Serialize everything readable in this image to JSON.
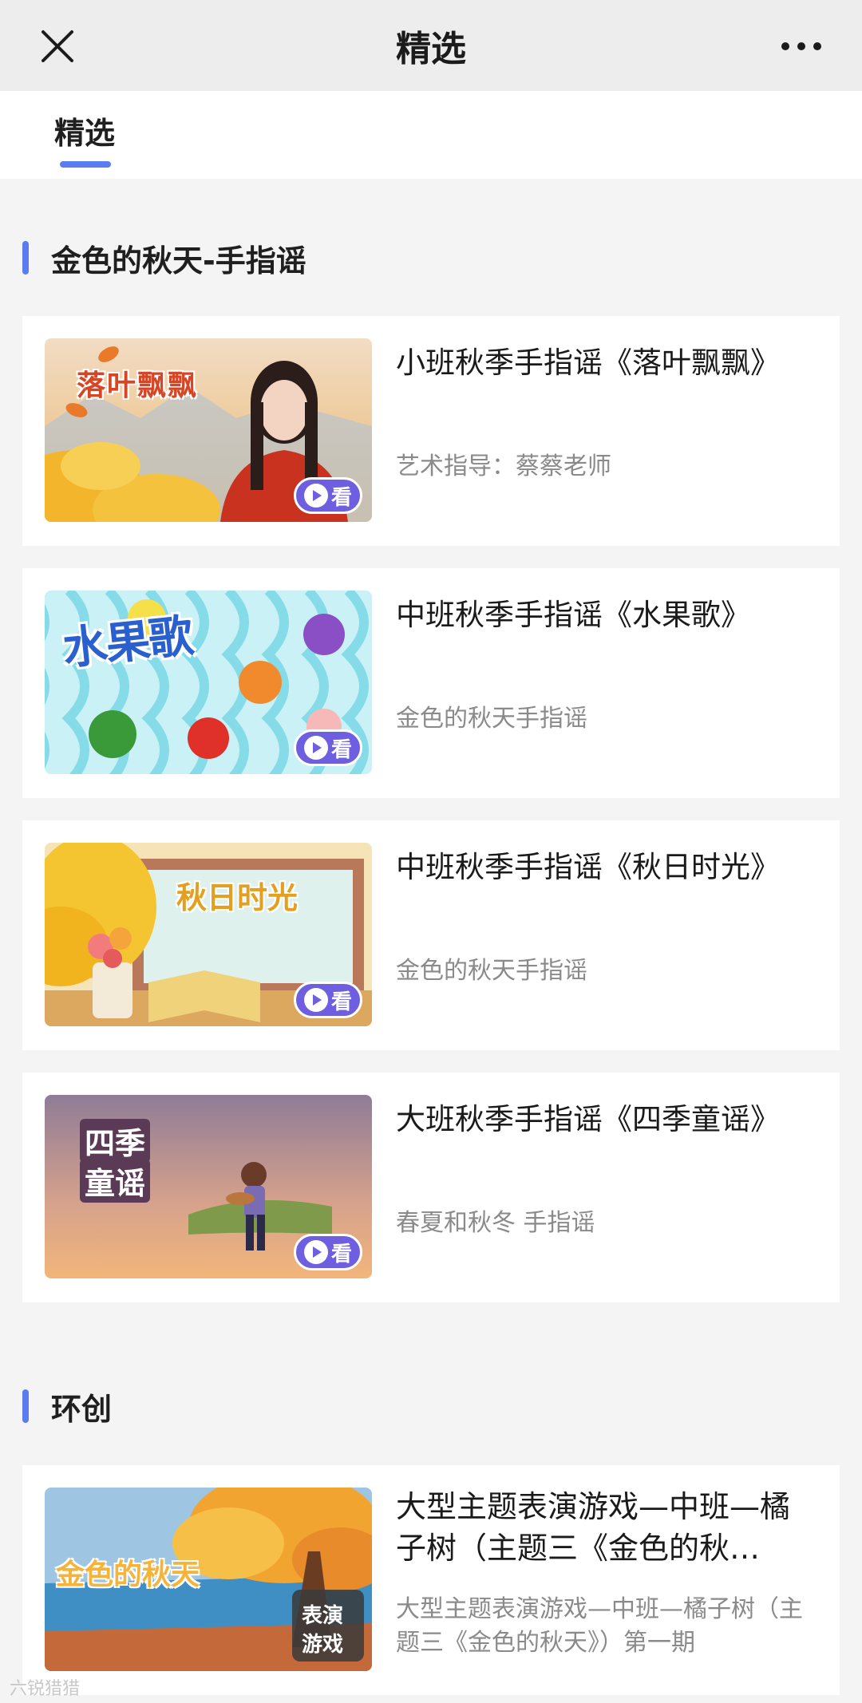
{
  "navbar": {
    "title": "精选",
    "close_icon": "close-icon",
    "more_icon": "more-icon"
  },
  "tabs": [
    {
      "label": "精选",
      "active": true
    }
  ],
  "sections": [
    {
      "title": "金色的秋天-手指谣",
      "cards": [
        {
          "title": "小班秋季手指谣《落叶飘飘》",
          "subtitle": "艺术指导：蔡蔡老师",
          "thumb_text": "落叶飘飘",
          "watch_label": "看"
        },
        {
          "title": "中班秋季手指谣《水果歌》",
          "subtitle": "金色的秋天手指谣",
          "thumb_text": "水果歌",
          "watch_label": "看"
        },
        {
          "title": "中班秋季手指谣《秋日时光》",
          "subtitle": "金色的秋天手指谣",
          "thumb_text": "秋日时光",
          "watch_label": "看"
        },
        {
          "title": "大班秋季手指谣《四季童谣》",
          "subtitle": "春夏和秋冬 手指谣",
          "thumb_text_line1": "四季",
          "thumb_text_line2": "童谣",
          "watch_label": "看"
        }
      ]
    },
    {
      "title": "环创",
      "cards": [
        {
          "title": "大型主题表演游戏—中班—橘子树（主题三《金色的秋…",
          "subtitle": "大型主题表演游戏—中班—橘子树（主题三《金色的秋天》）第一期",
          "thumb_text": "金色的秋天",
          "badge_line1": "表演",
          "badge_line2": "游戏"
        }
      ]
    }
  ],
  "watermark": "六锐猎猎",
  "colors": {
    "accent": "#5b7cf0",
    "watch_button": "#6d5fe0",
    "background": "#f4f4f5"
  }
}
